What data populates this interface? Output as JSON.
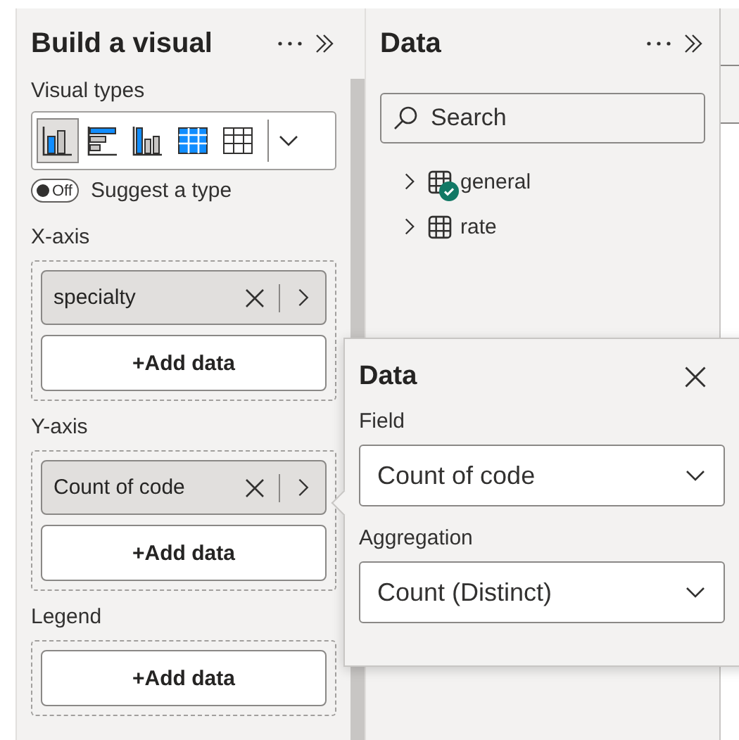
{
  "build_panel": {
    "title": "Build a visual",
    "visual_types_label": "Visual types",
    "visual_types": [
      {
        "kind": "clustered-column",
        "selected": true
      },
      {
        "kind": "stacked-bar",
        "selected": false
      },
      {
        "kind": "column",
        "selected": false
      },
      {
        "kind": "matrix",
        "selected": false
      },
      {
        "kind": "table",
        "selected": false
      }
    ],
    "suggest": {
      "label": "Suggest a type",
      "state_text": "Off",
      "on": false
    },
    "wells": [
      {
        "label": "X-axis",
        "fields": [
          "specialty"
        ],
        "add_label": "+Add data"
      },
      {
        "label": "Y-axis",
        "fields": [
          "Count of code"
        ],
        "add_label": "+Add data"
      },
      {
        "label": "Legend",
        "add_label": "+Add data"
      }
    ]
  },
  "data_panel": {
    "title": "Data",
    "search": {
      "placeholder": "Search"
    },
    "tables": [
      {
        "name": "general",
        "expanded": false,
        "checked": true
      },
      {
        "name": "rate",
        "expanded": false,
        "checked": false
      }
    ]
  },
  "popup": {
    "title": "Data",
    "fields": [
      {
        "label": "Field",
        "value": "Count of code"
      },
      {
        "label": "Aggregation",
        "value": "Count (Distinct)"
      }
    ]
  }
}
